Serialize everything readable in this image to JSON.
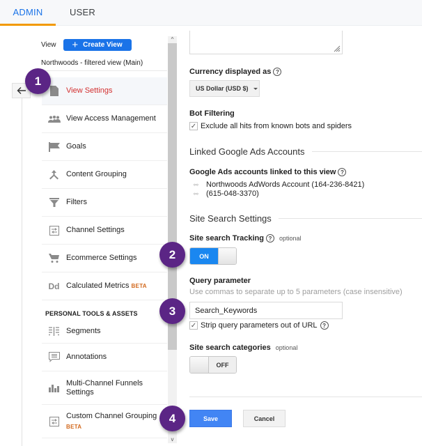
{
  "tabs": [
    {
      "label": "ADMIN",
      "active": true
    },
    {
      "label": "USER",
      "active": false
    }
  ],
  "colors": {
    "accent": "#1a73e8",
    "tab_indicator": "#f29900",
    "active_item_text": "#d32f2f",
    "beta": "#d2691e",
    "callout_badge": "#5b2585",
    "toggle_on": "#1a87f0",
    "save_button": "#4285f4"
  },
  "sidebar": {
    "view_label": "View",
    "create_view_label": "Create View",
    "create_view_icon": "plus-icon",
    "view_name": "Northwoods - filtered view (Main)",
    "back_icon": "arrow-left-icon",
    "items": [
      {
        "label": "View Settings",
        "icon": "document-icon",
        "active": true
      },
      {
        "label": "View Access Management",
        "icon": "people-icon"
      },
      {
        "label": "Goals",
        "icon": "flag-icon"
      },
      {
        "label": "Content Grouping",
        "icon": "merge-icon"
      },
      {
        "label": "Filters",
        "icon": "filter-icon"
      },
      {
        "label": "Channel Settings",
        "icon": "channel-icon"
      },
      {
        "label": "Ecommerce Settings",
        "icon": "cart-icon"
      },
      {
        "label": "Calculated Metrics",
        "icon": "dd-icon",
        "badge": "BETA"
      }
    ],
    "section_header": "PERSONAL TOOLS & ASSETS",
    "personal_items": [
      {
        "label": "Segments",
        "icon": "segments-icon"
      },
      {
        "label": "Annotations",
        "icon": "comment-icon"
      },
      {
        "label": "Multi-Channel Funnels Settings",
        "icon": "bar-chart-icon"
      },
      {
        "label": "Custom Channel Grouping",
        "icon": "channel-icon",
        "badge": "BETA"
      }
    ],
    "dd_glyph": "Dd"
  },
  "scrollbar": {
    "up_glyph": "^",
    "down_glyph": "v",
    "position_fraction": 0
  },
  "main": {
    "currency": {
      "label": "Currency displayed as",
      "help": "?",
      "value": "US Dollar (USD $)"
    },
    "bot_filtering": {
      "label": "Bot Filtering",
      "checkbox_label": "Exclude all hits from known bots and spiders",
      "checked": true
    },
    "linked_ads": {
      "section_title": "Linked Google Ads Accounts",
      "label": "Google Ads accounts linked to this view",
      "help": "?",
      "accounts": [
        "Northwoods AdWords Account (164-236-8421)",
        "(615-048-3370)"
      ],
      "link_glyph": "⚯"
    },
    "site_search": {
      "section_title": "Site Search Settings",
      "tracking_label": "Site search Tracking",
      "help": "?",
      "optional": "optional",
      "tracking_state": "ON",
      "query_label": "Query parameter",
      "query_hint": "Use commas to separate up to 5 parameters (case insensitive)",
      "query_value": "Search_Keywords",
      "strip_label": "Strip query parameters out of URL",
      "strip_checked": true,
      "categories_label": "Site search categories",
      "categories_optional": "optional",
      "categories_state": "OFF"
    },
    "save_label": "Save",
    "cancel_label": "Cancel",
    "check_glyph": "✓"
  },
  "callouts": [
    "1",
    "2",
    "3",
    "4"
  ]
}
